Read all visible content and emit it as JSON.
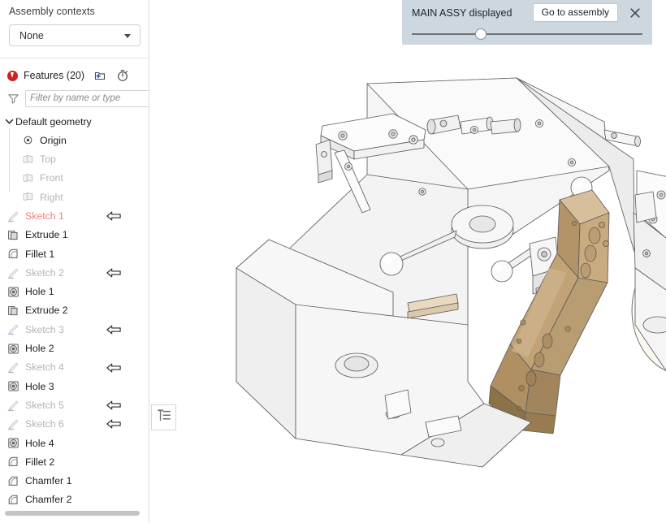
{
  "sidebar": {
    "assembly_contexts_label": "Assembly contexts",
    "context_dropdown": {
      "value": "None",
      "caret_icon": "chevron-down-icon"
    },
    "features_header": {
      "error_icon": "error-badge-icon",
      "title": "Features (20)",
      "new_folder_icon": "new-folder-icon",
      "history_icon": "stopwatch-icon"
    },
    "filter": {
      "funnel_icon": "funnel-icon",
      "placeholder": "Filter by name or type",
      "value": ""
    },
    "tree": [
      {
        "label": "Default geometry",
        "icon": "chevron-down-icon",
        "type": "folder",
        "state": "normal",
        "expanded": true,
        "indent": 0,
        "rollback_arrow": false
      },
      {
        "label": "Origin",
        "icon": "origin-icon",
        "type": "origin",
        "state": "normal",
        "indent": 1,
        "rollback_arrow": false
      },
      {
        "label": "Top",
        "icon": "plane-icon",
        "type": "plane",
        "state": "dim",
        "indent": 1,
        "rollback_arrow": false
      },
      {
        "label": "Front",
        "icon": "plane-icon",
        "type": "plane",
        "state": "dim",
        "indent": 1,
        "rollback_arrow": false
      },
      {
        "label": "Right",
        "icon": "plane-icon",
        "type": "plane",
        "state": "dim",
        "indent": 1,
        "rollback_arrow": false
      },
      {
        "label": "Sketch 1",
        "icon": "sketch-icon",
        "type": "sketch",
        "state": "error",
        "indent": 0,
        "rollback_arrow": true
      },
      {
        "label": "Extrude 1",
        "icon": "extrude-icon",
        "type": "extrude",
        "state": "normal",
        "indent": 0,
        "rollback_arrow": false
      },
      {
        "label": "Fillet 1",
        "icon": "fillet-icon",
        "type": "fillet",
        "state": "normal",
        "indent": 0,
        "rollback_arrow": false
      },
      {
        "label": "Sketch 2",
        "icon": "sketch-icon",
        "type": "sketch",
        "state": "dim",
        "indent": 0,
        "rollback_arrow": true
      },
      {
        "label": "Hole 1",
        "icon": "hole-icon",
        "type": "hole",
        "state": "normal",
        "indent": 0,
        "rollback_arrow": false
      },
      {
        "label": "Extrude 2",
        "icon": "extrude-icon",
        "type": "extrude",
        "state": "normal",
        "indent": 0,
        "rollback_arrow": false
      },
      {
        "label": "Sketch 3",
        "icon": "sketch-icon",
        "type": "sketch",
        "state": "dim",
        "indent": 0,
        "rollback_arrow": true
      },
      {
        "label": "Hole 2",
        "icon": "hole-icon",
        "type": "hole",
        "state": "normal",
        "indent": 0,
        "rollback_arrow": false
      },
      {
        "label": "Sketch 4",
        "icon": "sketch-icon",
        "type": "sketch",
        "state": "dim",
        "indent": 0,
        "rollback_arrow": true
      },
      {
        "label": "Hole 3",
        "icon": "hole-icon",
        "type": "hole",
        "state": "normal",
        "indent": 0,
        "rollback_arrow": false
      },
      {
        "label": "Sketch 5",
        "icon": "sketch-icon",
        "type": "sketch",
        "state": "dim",
        "indent": 0,
        "rollback_arrow": true
      },
      {
        "label": "Sketch 6",
        "icon": "sketch-icon",
        "type": "sketch",
        "state": "dim",
        "indent": 0,
        "rollback_arrow": true
      },
      {
        "label": "Hole 4",
        "icon": "hole-icon",
        "type": "hole",
        "state": "normal",
        "indent": 0,
        "rollback_arrow": false
      },
      {
        "label": "Fillet 2",
        "icon": "fillet-icon",
        "type": "fillet",
        "state": "normal",
        "indent": 0,
        "rollback_arrow": false
      },
      {
        "label": "Chamfer 1",
        "icon": "chamfer-icon",
        "type": "chamfer",
        "state": "normal",
        "indent": 0,
        "rollback_arrow": false
      },
      {
        "label": "Chamfer 2",
        "icon": "chamfer-icon",
        "type": "chamfer",
        "state": "normal",
        "indent": 0,
        "rollback_arrow": false
      }
    ],
    "horizontal_scrollbar": {
      "name": "feature-tree-hscrollbar"
    }
  },
  "notification": {
    "message": "MAIN ASSY displayed",
    "action_label": "Go to assembly",
    "close_icon": "close-icon",
    "slider": {
      "value_percent": 30
    },
    "background_color": "#ccd7df"
  },
  "viewport": {
    "tree_toggle_icon": "feature-list-icon",
    "background_color": "#ffffff",
    "model": {
      "highlighted_part_color": "#c1a378",
      "secondary_part_color": "#f0e0cb",
      "body_color": "#f2f2f2",
      "edge_color": "#5d5d5d",
      "origin_marker_visible": true
    }
  }
}
